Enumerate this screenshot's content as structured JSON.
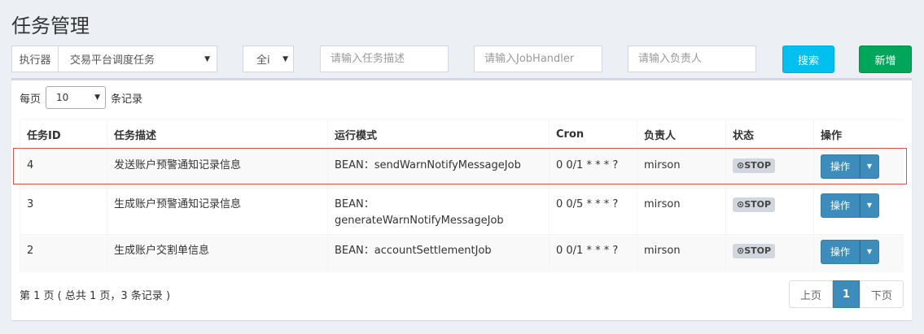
{
  "page": {
    "title": "任务管理"
  },
  "filters": {
    "executor_label": "执行器",
    "executor_value": "交易平台调度任务",
    "status_value": "全i",
    "desc_placeholder": "请输入任务描述",
    "handler_placeholder": "请输入JobHandler",
    "author_placeholder": "请输入负责人",
    "search_label": "搜索",
    "add_label": "新增"
  },
  "length": {
    "prefix": "每页",
    "value": "10",
    "suffix": "条记录"
  },
  "table": {
    "headers": [
      "任务ID",
      "任务描述",
      "运行模式",
      "Cron",
      "负责人",
      "状态",
      "操作"
    ],
    "rows": [
      {
        "id": "4",
        "desc": "发送账户预警通知记录信息",
        "mode_prefix": "BEAN：",
        "mode_handler": "sendWarnNotifyMessageJob",
        "cron": "0 0/1 * * * ?",
        "author": "mirson",
        "status": "STOP",
        "op": "操作"
      },
      {
        "id": "3",
        "desc": "生成账户预警通知记录信息",
        "mode_prefix": "BEAN：",
        "mode_handler": "generateWarnNotifyMessageJob",
        "cron": "0 0/5 * * * ?",
        "author": "mirson",
        "status": "STOP",
        "op": "操作"
      },
      {
        "id": "2",
        "desc": "生成账户交割单信息",
        "mode_prefix": "BEAN：",
        "mode_handler": "accountSettlementJob",
        "cron": "0 0/1 * * * ?",
        "author": "mirson",
        "status": "STOP",
        "op": "操作"
      }
    ]
  },
  "footer": {
    "info": "第 1 页 ( 总共 1 页，3 条记录 )",
    "prev": "上页",
    "current": "1",
    "next": "下页"
  },
  "icons": {
    "status": "clock-icon",
    "dropdown": "caret-down-icon"
  },
  "colors": {
    "search": "#00c0ef",
    "add": "#00a65a",
    "primary": "#3c8dbc",
    "highlight": "#d9534f"
  }
}
